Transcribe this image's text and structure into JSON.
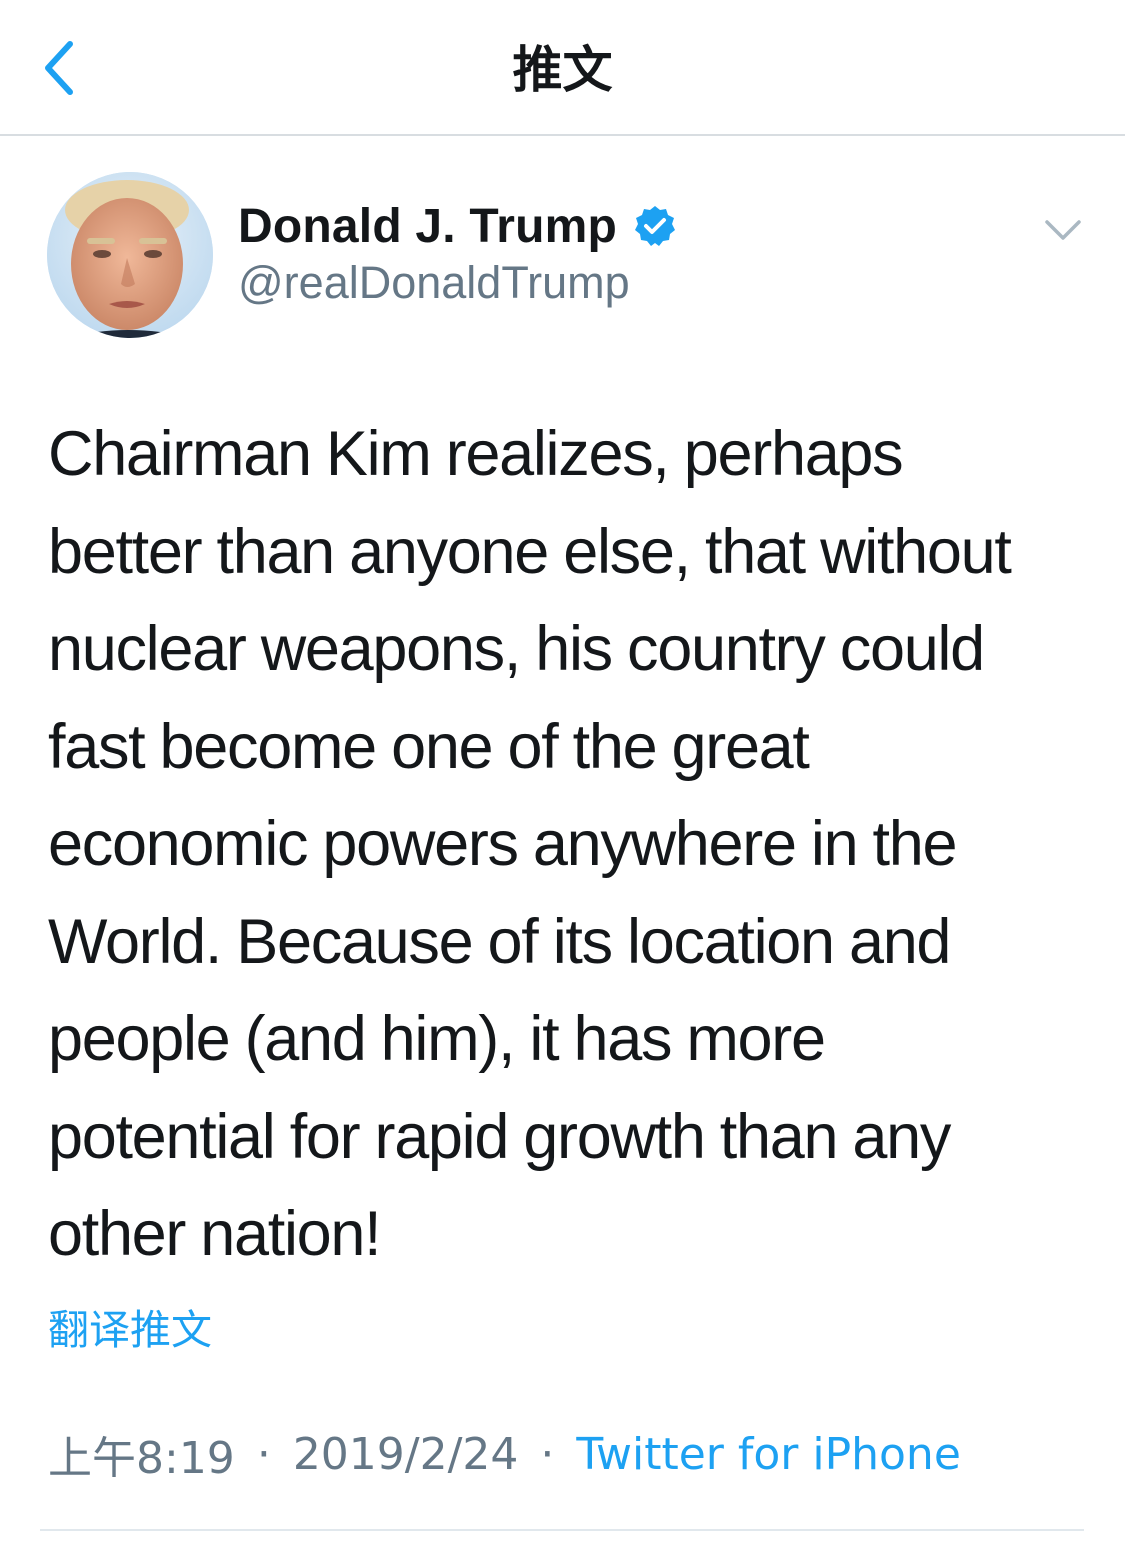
{
  "navbar": {
    "title": "推文",
    "back_icon": "chevron-left-icon",
    "accent_color": "#1da1f2"
  },
  "author": {
    "display_name": "Donald J. Trump",
    "handle": "@realDonaldTrump",
    "verified": true,
    "verified_icon": "verified-badge-icon",
    "menu_icon": "chevron-down-icon"
  },
  "tweet": {
    "text": "Chairman Kim realizes, perhaps\nbetter than anyone else, that without\nnuclear weapons, his country could\nfast become one of the great\neconomic powers anywhere in the\nWorld. Because of its location and\npeople (and him), it has more\npotential for rapid growth than any\nother nation!",
    "translate_label": "翻译推文"
  },
  "meta": {
    "time": "上午8:19",
    "separator": "·",
    "date": "2019/2/24",
    "source": "Twitter for iPhone"
  },
  "colors": {
    "text_primary": "#14171a",
    "text_secondary": "#657786",
    "link": "#1da1f2",
    "divider": "#e1e8ed"
  }
}
